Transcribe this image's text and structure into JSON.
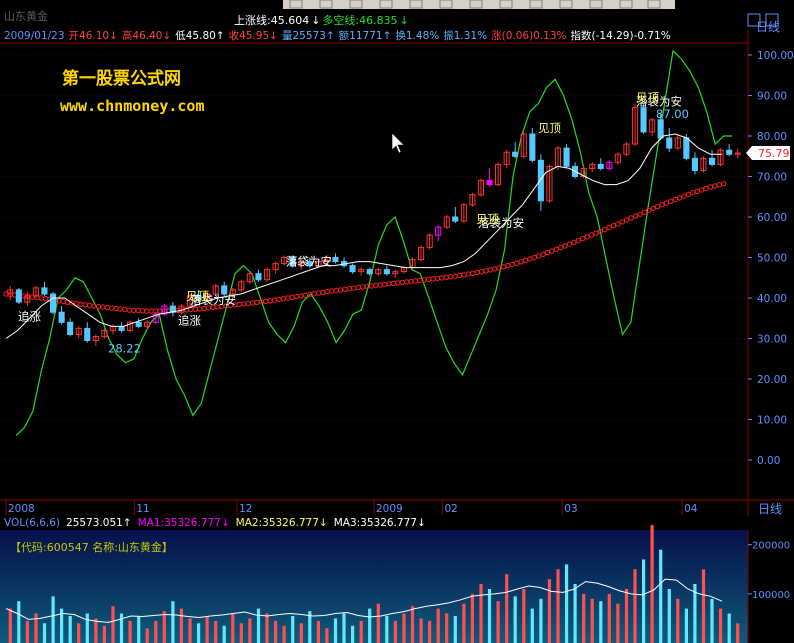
{
  "colors": {
    "background": "#000000",
    "frame": "#8b0000",
    "axis_text": "#5f8fff",
    "up_candle": "#ff3030",
    "down_candle": "#55c8ff",
    "purple_candle": "#ff00ff",
    "ma_white": "#ffffff",
    "ma_red": "#ff2020",
    "green_line": "#22dd22",
    "vol_panel_top": "#06104a",
    "vol_panel_bottom": "#0f5a7a"
  },
  "header": {
    "title_obscured": "山东黄金",
    "line1": [
      {
        "text": "上涨线:45.604",
        "color": "#ffffff"
      },
      {
        "text": "↓",
        "color": "#ffffff"
      },
      {
        "text": "多空线:46.835",
        "color": "#22dd22"
      },
      {
        "text": "↓",
        "color": "#22dd22"
      }
    ],
    "line2": [
      {
        "text": "2009/01/23",
        "color": "#5f8fff"
      },
      {
        "text": "开46.10↓",
        "color": "#ff4040"
      },
      {
        "text": "高46.40↓",
        "color": "#ff4040"
      },
      {
        "text": "低45.80↑",
        "color": "#ffffff"
      },
      {
        "text": "收45.95↓",
        "color": "#ff4040"
      },
      {
        "text": "量25573↑",
        "color": "#5fafff"
      },
      {
        "text": "额11771↑",
        "color": "#5fafff"
      },
      {
        "text": "换1.48%",
        "color": "#5fafff"
      },
      {
        "text": "振1.31%",
        "color": "#5fafff"
      },
      {
        "text": "涨(0.06)0.13%",
        "color": "#ff4040"
      },
      {
        "text": "指数(-14.29)-0.71%",
        "color": "#ffffff"
      }
    ]
  },
  "watermark": {
    "name": "第一股票公式网",
    "url": "www.chnmoney.com"
  },
  "right_axis": {
    "top_label": "日线",
    "ticks": [
      "100.00",
      "90.00",
      "80.00",
      "70.00",
      "60.00",
      "50.00",
      "40.00",
      "30.00",
      "20.00",
      "10.00",
      "0.00"
    ],
    "current_price": "75.79"
  },
  "time_axis": {
    "labels": [
      "2008",
      "11",
      "12",
      "2009",
      "02",
      "03",
      "04"
    ],
    "right_label": "日线"
  },
  "volume_header": {
    "items": [
      {
        "text": "VOL(6,6,6)",
        "color": "#5f8fff"
      },
      {
        "text": "25573.051↑",
        "color": "#ffffff"
      },
      {
        "text": "MA1:35326.777↓",
        "color": "#ff00ff"
      },
      {
        "text": "MA2:35326.777↓",
        "color": "#ffff66"
      },
      {
        "text": "MA3:35326.777↓",
        "color": "#ffffff"
      }
    ]
  },
  "volume_info": {
    "code_label": "【代码:600547 名称:山东黄金】"
  },
  "volume_axis": {
    "ticks": [
      "200000",
      "100000"
    ]
  },
  "chart_data": [
    {
      "type": "candlestick",
      "panel": "price",
      "ylim": [
        0,
        100
      ],
      "yticks": [
        0,
        10,
        20,
        30,
        40,
        50,
        60,
        70,
        80,
        90,
        100
      ],
      "x_labels": [
        "2008",
        "11",
        "12",
        "2009",
        "02",
        "03",
        "04"
      ],
      "candles": [
        [
          41.0,
          43.0,
          39.5,
          42.0
        ],
        [
          42.0,
          42.5,
          38.5,
          39.0
        ],
        [
          39.0,
          41.5,
          38.0,
          40.5
        ],
        [
          40.5,
          43.0,
          40.0,
          42.5
        ],
        [
          42.5,
          44.0,
          40.5,
          41.0
        ],
        [
          41.0,
          41.5,
          36.0,
          36.5
        ],
        [
          36.5,
          38.0,
          33.5,
          34.0
        ],
        [
          34.0,
          35.0,
          30.5,
          31.0
        ],
        [
          31.0,
          33.0,
          30.0,
          32.5
        ],
        [
          32.5,
          34.0,
          29.0,
          29.5
        ],
        [
          29.5,
          31.0,
          28.2,
          30.5
        ],
        [
          30.5,
          32.5,
          30.0,
          32.0
        ],
        [
          32.0,
          33.5,
          31.0,
          33.0
        ],
        [
          33.0,
          34.0,
          31.5,
          32.0
        ],
        [
          32.0,
          34.5,
          31.5,
          34.0
        ],
        [
          34.0,
          35.0,
          32.5,
          33.0
        ],
        [
          33.0,
          34.5,
          32.0,
          34.0
        ],
        [
          34.0,
          36.5,
          33.5,
          36.0
        ],
        [
          36.0,
          38.5,
          35.5,
          38.0
        ],
        [
          38.0,
          39.0,
          35.5,
          36.5
        ],
        [
          36.5,
          38.5,
          36.0,
          38.0
        ],
        [
          38.0,
          41.0,
          37.5,
          40.5
        ],
        [
          40.5,
          42.0,
          39.0,
          39.5
        ],
        [
          39.5,
          41.5,
          39.0,
          41.0
        ],
        [
          41.0,
          43.5,
          40.5,
          43.0
        ],
        [
          43.0,
          44.0,
          40.5,
          41.0
        ],
        [
          41.0,
          42.5,
          39.5,
          42.0
        ],
        [
          42.0,
          44.5,
          41.5,
          44.0
        ],
        [
          44.0,
          46.5,
          43.5,
          46.0
        ],
        [
          46.0,
          47.0,
          44.0,
          44.5
        ],
        [
          44.5,
          47.5,
          44.0,
          47.0
        ],
        [
          47.0,
          49.0,
          46.0,
          48.5
        ],
        [
          48.5,
          50.5,
          48.0,
          50.0
        ],
        [
          50.0,
          50.5,
          47.5,
          48.0
        ],
        [
          48.0,
          49.5,
          47.0,
          49.0
        ],
        [
          49.0,
          50.0,
          47.5,
          48.0
        ],
        [
          48.0,
          49.5,
          47.5,
          49.0
        ],
        [
          49.0,
          50.5,
          48.5,
          50.0
        ],
        [
          50.0,
          51.0,
          48.5,
          49.0
        ],
        [
          49.0,
          50.0,
          47.5,
          48.0
        ],
        [
          48.0,
          48.5,
          46.0,
          46.5
        ],
        [
          46.5,
          47.5,
          45.5,
          47.0
        ],
        [
          47.0,
          47.5,
          45.5,
          46.0
        ],
        [
          46.0,
          47.5,
          45.5,
          47.0
        ],
        [
          47.0,
          48.0,
          45.5,
          46.0
        ],
        [
          46.0,
          47.0,
          45.0,
          46.5
        ],
        [
          46.5,
          48.0,
          46.0,
          47.5
        ],
        [
          47.5,
          50.0,
          47.0,
          49.5
        ],
        [
          49.5,
          53.0,
          49.0,
          52.5
        ],
        [
          52.5,
          56.0,
          52.0,
          55.5
        ],
        [
          55.5,
          58.0,
          54.0,
          57.5
        ],
        [
          57.5,
          60.5,
          57.0,
          60.0
        ],
        [
          60.0,
          62.5,
          58.5,
          59.0
        ],
        [
          59.0,
          63.5,
          58.5,
          63.0
        ],
        [
          63.0,
          66.0,
          62.5,
          65.5
        ],
        [
          65.5,
          69.5,
          65.0,
          69.0
        ],
        [
          69.0,
          72.0,
          67.5,
          68.0
        ],
        [
          68.0,
          73.5,
          67.5,
          73.0
        ],
        [
          73.0,
          76.5,
          72.0,
          76.0
        ],
        [
          76.0,
          78.5,
          74.5,
          75.0
        ],
        [
          75.0,
          81.0,
          74.5,
          80.5
        ],
        [
          80.5,
          82.0,
          73.5,
          74.0
        ],
        [
          74.0,
          75.5,
          61.5,
          64.0
        ],
        [
          64.0,
          73.0,
          63.5,
          72.5
        ],
        [
          72.5,
          77.5,
          71.5,
          77.0
        ],
        [
          77.0,
          78.0,
          72.0,
          72.5
        ],
        [
          72.5,
          73.5,
          69.5,
          70.0
        ],
        [
          70.0,
          72.5,
          69.5,
          72.0
        ],
        [
          72.0,
          73.5,
          71.0,
          73.0
        ],
        [
          73.0,
          74.5,
          71.5,
          72.0
        ],
        [
          72.0,
          74.0,
          71.5,
          73.5
        ],
        [
          73.5,
          76.0,
          73.0,
          75.5
        ],
        [
          75.5,
          78.5,
          75.0,
          78.0
        ],
        [
          78.0,
          88.0,
          77.5,
          87.0
        ],
        [
          87.0,
          88.0,
          80.5,
          81.0
        ],
        [
          81.0,
          84.5,
          80.0,
          84.0
        ],
        [
          84.0,
          85.5,
          79.0,
          79.5
        ],
        [
          79.5,
          82.0,
          76.0,
          77.0
        ],
        [
          77.0,
          80.0,
          76.5,
          79.5
        ],
        [
          79.5,
          80.5,
          74.0,
          74.5
        ],
        [
          74.5,
          76.0,
          70.5,
          71.5
        ],
        [
          71.5,
          75.0,
          71.0,
          74.5
        ],
        [
          74.5,
          76.5,
          72.5,
          73.0
        ],
        [
          73.0,
          77.0,
          72.5,
          76.5
        ],
        [
          76.5,
          78.0,
          75.0,
          75.5
        ],
        [
          75.5,
          77.0,
          74.5,
          75.8
        ]
      ],
      "special_purple_indices": [
        17,
        18,
        50,
        56,
        70
      ],
      "green_indicator_values": [
        6,
        8,
        12,
        22,
        30,
        40,
        42,
        45,
        44,
        40,
        36,
        30,
        26,
        24,
        25,
        30,
        34,
        36,
        27,
        20,
        16,
        11,
        14,
        22,
        30,
        38,
        46,
        48,
        46,
        40,
        34,
        31,
        29,
        33,
        39,
        41,
        38,
        34,
        29,
        32,
        36,
        37,
        44,
        53,
        58,
        60,
        54,
        47,
        46,
        40,
        34,
        28,
        24,
        21,
        26,
        31,
        36,
        42,
        52,
        70,
        80,
        86,
        88,
        92,
        94,
        90,
        84,
        76,
        66,
        60,
        50,
        40,
        31,
        34,
        48,
        62,
        75,
        88,
        101,
        99,
        96,
        92,
        86,
        78,
        80,
        80
      ],
      "white_ma_values": [
        30,
        32,
        35,
        38,
        40,
        40,
        38,
        36,
        34,
        33,
        33,
        34,
        35,
        36,
        36.5,
        37,
        38,
        39,
        40,
        40.5,
        41,
        42,
        43,
        44,
        45,
        46,
        47,
        48,
        48,
        48.5,
        49,
        49,
        48.5,
        48,
        47.5,
        47.5,
        47.5,
        47.5,
        48,
        49,
        51,
        54,
        57,
        60,
        63,
        67,
        71,
        72.5,
        72,
        70.5,
        69,
        68,
        68,
        69,
        72,
        77,
        80,
        80.5,
        79.5,
        77,
        75.5,
        75.5
      ],
      "red_ma_values": [
        41,
        40.5,
        40,
        39.3,
        38.6,
        38,
        37.5,
        37,
        36.8,
        36.8,
        37,
        37.3,
        37.8,
        38.3,
        38.8,
        39.3,
        40,
        40.7,
        41.4,
        42,
        42.6,
        43.1,
        43.6,
        44.1,
        44.6,
        45.1,
        45.7,
        46.5,
        47.4,
        48.6,
        50,
        51.6,
        53.3,
        55.1,
        56.9,
        58.8,
        60.7,
        62.6,
        64.3,
        66,
        67.4,
        68.5
      ],
      "annotations": [
        {
          "text": "追涨",
          "value": 34.5,
          "color": "#ffffff"
        },
        {
          "text": "28.22",
          "value": 26.5,
          "color": "#55c8ff"
        },
        {
          "text": "追涨",
          "value": 33.5,
          "color": "#ffffff"
        },
        {
          "text": "落袋为安",
          "value": 38.5,
          "color": "#ffffff"
        },
        {
          "text": "见顶",
          "value": 39.5,
          "color": "#ffff66"
        },
        {
          "text": "落袋为安",
          "value": 48.0,
          "color": "#ffffff"
        },
        {
          "text": "落袋为安",
          "value": 57.5,
          "color": "#ffffff"
        },
        {
          "text": "见顶",
          "value": 58.5,
          "color": "#ffff66"
        },
        {
          "text": "见顶",
          "value": 81.0,
          "color": "#ffff66"
        },
        {
          "text": "落袋为安",
          "value": 87.5,
          "color": "#ffffff"
        },
        {
          "text": "见顶",
          "value": 88.5,
          "color": "#ffff66"
        },
        {
          "text": "87.00",
          "value": 84.5,
          "color": "#55c8ff"
        }
      ]
    },
    {
      "type": "bar",
      "panel": "volume",
      "ylim": [
        0,
        230000
      ],
      "values": [
        70000,
        85000,
        45000,
        60000,
        40000,
        95000,
        70000,
        55000,
        40000,
        60000,
        50000,
        35000,
        75000,
        60000,
        45000,
        55000,
        30000,
        45000,
        65000,
        85000,
        70000,
        50000,
        40000,
        55000,
        45000,
        35000,
        60000,
        40000,
        50000,
        70000,
        60000,
        45000,
        35000,
        55000,
        40000,
        65000,
        45000,
        30000,
        50000,
        60000,
        35000,
        45000,
        70000,
        80000,
        55000,
        45000,
        60000,
        75000,
        50000,
        45000,
        70000,
        60000,
        55000,
        80000,
        100000,
        120000,
        110000,
        85000,
        140000,
        95000,
        110000,
        70000,
        90000,
        130000,
        150000,
        160000,
        120000,
        100000,
        90000,
        85000,
        100000,
        80000,
        110000,
        150000,
        170000,
        240000,
        190000,
        110000,
        90000,
        70000,
        120000,
        150000,
        90000,
        70000,
        60000,
        40000
      ],
      "ma_values": [
        70000,
        60000,
        48000,
        50000,
        55000,
        60000,
        58000,
        48000,
        44000,
        42000,
        48000,
        55000,
        54000,
        56000,
        58000,
        57000,
        54000,
        52000,
        55000,
        57000,
        60000,
        63000,
        57000,
        55000,
        58000,
        60000,
        58000,
        55000,
        56000,
        60000,
        62000,
        56000,
        53000,
        55000,
        60000,
        64000,
        70000,
        75000,
        78000,
        82000,
        88000,
        95000,
        98000,
        100000,
        103000,
        110000,
        116000,
        113000,
        105000,
        103000,
        110000,
        125000,
        122000,
        115000,
        106000,
        100000,
        98000,
        108000,
        130000,
        128000,
        110000,
        100000,
        95000,
        85000
      ]
    }
  ]
}
